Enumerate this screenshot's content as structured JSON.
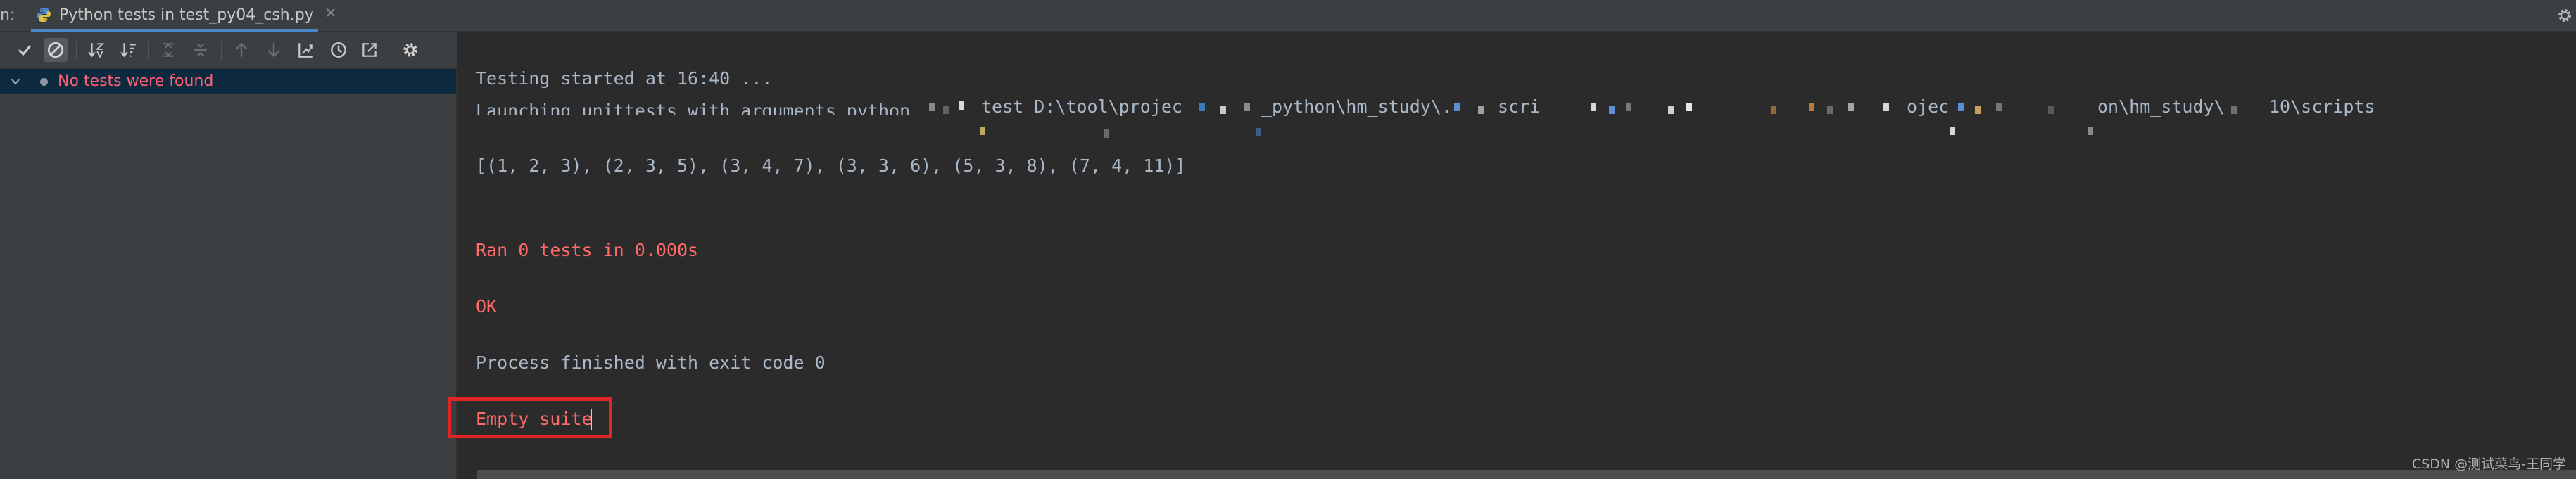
{
  "tabbar": {
    "prefix": "n:",
    "run_tab_title": "Python tests in test_py04_csh.py",
    "close_glyph": "×"
  },
  "toolbar": {
    "buttons": [
      {
        "icon": "check-icon",
        "pressed": false
      },
      {
        "icon": "ignored-filter-icon",
        "pressed": true
      },
      {
        "icon": "sort-alpha-icon",
        "pressed": false
      },
      {
        "icon": "sort-duration-icon",
        "pressed": false
      },
      {
        "icon": "expand-all-icon",
        "pressed": false
      },
      {
        "icon": "collapse-all-icon",
        "pressed": false
      },
      {
        "icon": "arrow-up-icon",
        "pressed": false
      },
      {
        "icon": "arrow-down-icon",
        "pressed": false
      },
      {
        "icon": "import-tests-icon",
        "pressed": false
      },
      {
        "icon": "history-clock-icon",
        "pressed": false
      },
      {
        "icon": "export-icon",
        "pressed": false
      },
      {
        "icon": "settings-gear-icon",
        "pressed": false
      }
    ]
  },
  "tree": {
    "root_label": "No tests were found"
  },
  "console": {
    "line_started": "Testing started at 16:40 ...",
    "line_launch_a": "Launching unittests with arguments python",
    "line_launch_b": "test D:\\tool\\projec",
    "line_launch_c": "_python\\hm_study\\.",
    "line_launch_d": "scri",
    "line_launch_e": "ojec",
    "line_launch_f": "on\\hm_study\\",
    "line_launch_g": "10\\scripts",
    "line_result": "[(1, 2, 3), (2, 3, 5), (3, 4, 7), (3, 3, 6), (5, 3, 8), (7, 4, 11)]",
    "line_ran": "Ran 0 tests in 0.000s",
    "line_ok": "OK",
    "line_exit": "Process finished with exit code 0",
    "line_empty": "Empty suite"
  },
  "watermark": "CSDN @测试菜鸟-王同学",
  "colors": {
    "background": "#2b2b2b",
    "panel": "#3c3f41",
    "error_text": "#ff6b68",
    "tree_error_text": "#ff5f76",
    "highlight_box": "#e52525",
    "tab_accent": "#4a88c7"
  }
}
